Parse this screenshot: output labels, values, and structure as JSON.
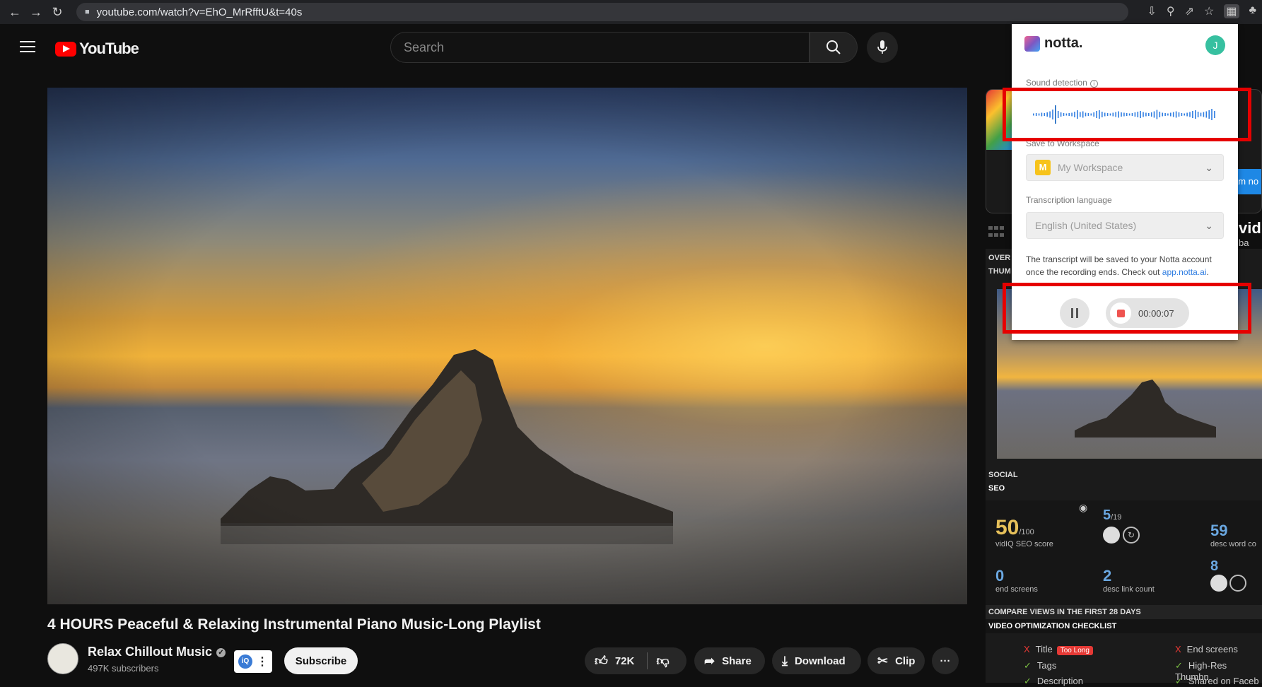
{
  "browser": {
    "url": "youtube.com/watch?v=EhO_MrRfftU&t=40s"
  },
  "header": {
    "logo_text": "YouTube",
    "search_placeholder": "Search"
  },
  "video": {
    "title": "4 HOURS Peaceful & Relaxing Instrumental Piano Music-Long Playlist",
    "channel": "Relax Chillout Music",
    "subscribers": "497K subscribers",
    "subscribe_label": "Subscribe",
    "likes": "72K",
    "share_label": "Share",
    "download_label": "Download",
    "clip_label": "Clip",
    "more_label": "···"
  },
  "notta": {
    "brand": "notta.",
    "user_initial": "J",
    "sound_detection_label": "Sound detection",
    "workspace_label": "Save to Workspace",
    "workspace_value": "My Workspace",
    "workspace_initial": "M",
    "language_label": "Transcription language",
    "language_value": "English (United States)",
    "note_text": "The transcript will be saved to your Notta account once the recording ends. Check out",
    "note_link": "app.notta.ai",
    "note_end": ".",
    "timer": "00:00:07",
    "accent": "#2f7de1"
  },
  "side": {
    "ad_button_fragment": "am no",
    "brand_fragment": "vid",
    "brand_sub": "ba"
  },
  "vidiq": {
    "tab1": "OVER",
    "tab2": "THUM",
    "social": "SOCIAL",
    "seo": "SEO",
    "seo_score": "50",
    "seo_score_max": "/100",
    "seo_score_label": "vidIQ SEO score",
    "tags_count": "5",
    "tags_total": "/19",
    "desc_words": "59",
    "desc_words_label": "desc word co",
    "end_screens": "0",
    "end_screens_label": "end screens",
    "desc_links": "2",
    "desc_links_label": "desc link count",
    "cards": "8",
    "compare_label": "COMPARE VIEWS IN THE FIRST 28 DAYS",
    "checklist_label": "VIDEO OPTIMIZATION CHECKLIST",
    "check_title": "Title",
    "check_title_badge": "Too Long",
    "check_tags": "Tags",
    "check_description": "Description",
    "check_endscreens": "End screens",
    "check_highres": "High-Res Thumbn",
    "check_shared": "Shared on Faceb"
  }
}
